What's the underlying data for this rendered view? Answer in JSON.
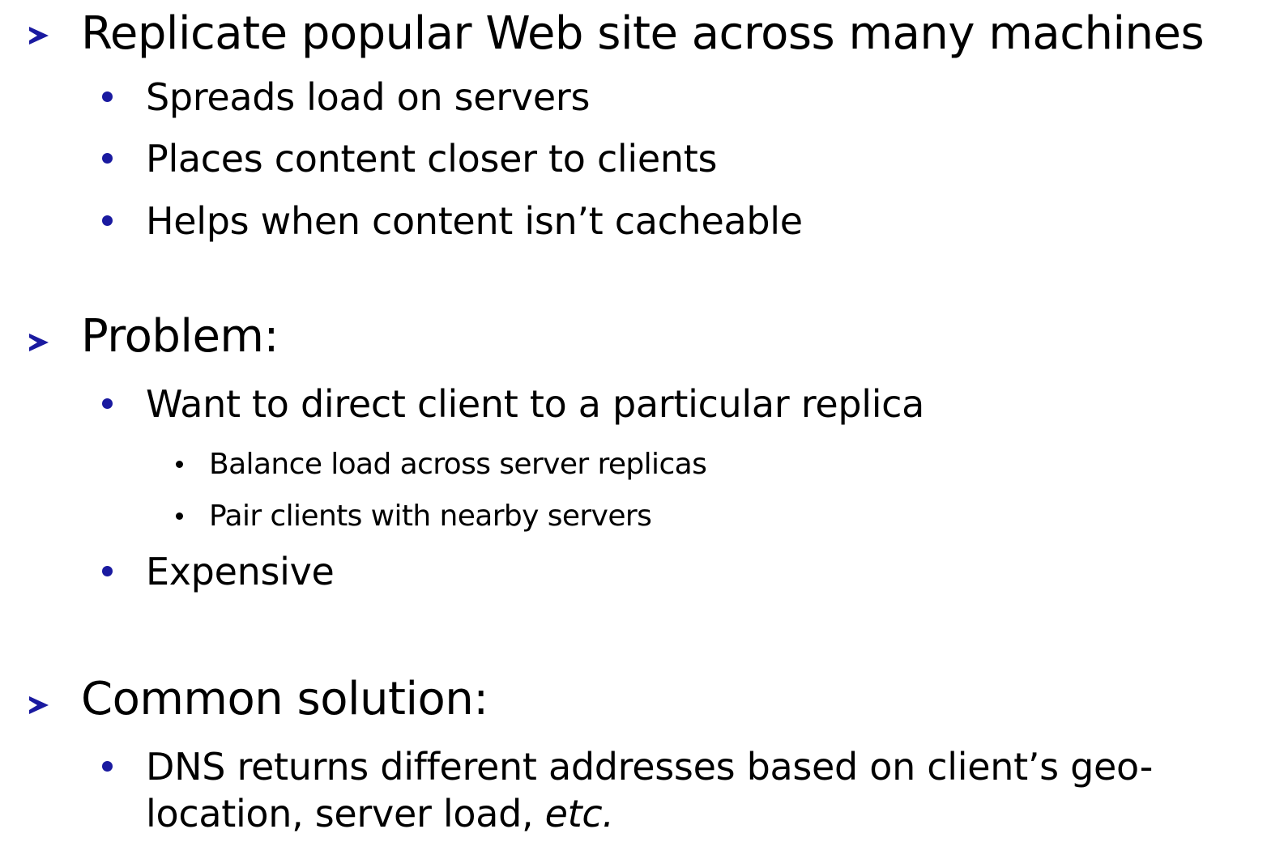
{
  "slide": {
    "sections": [
      {
        "heading": "Replicate popular Web site across many machines",
        "bullets": [
          "Spreads load on servers",
          "Places content closer to clients",
          "Helps when content isn’t cacheable"
        ]
      },
      {
        "heading": "Problem:",
        "bullets": [
          {
            "text": "Want to direct client to a particular replica",
            "sub": [
              "Balance load across server replicas",
              "Pair clients with nearby servers"
            ]
          },
          "Expensive"
        ]
      },
      {
        "heading": "Common solution:",
        "bullets": [
          {
            "line1": "DNS returns different addresses based on client’s geo-",
            "line2": "location, server load, ",
            "line2_italic": "etc."
          }
        ]
      }
    ]
  },
  "colors": {
    "bullet_accent": "#1a1aa0",
    "text": "#000000",
    "background": "#ffffff"
  }
}
